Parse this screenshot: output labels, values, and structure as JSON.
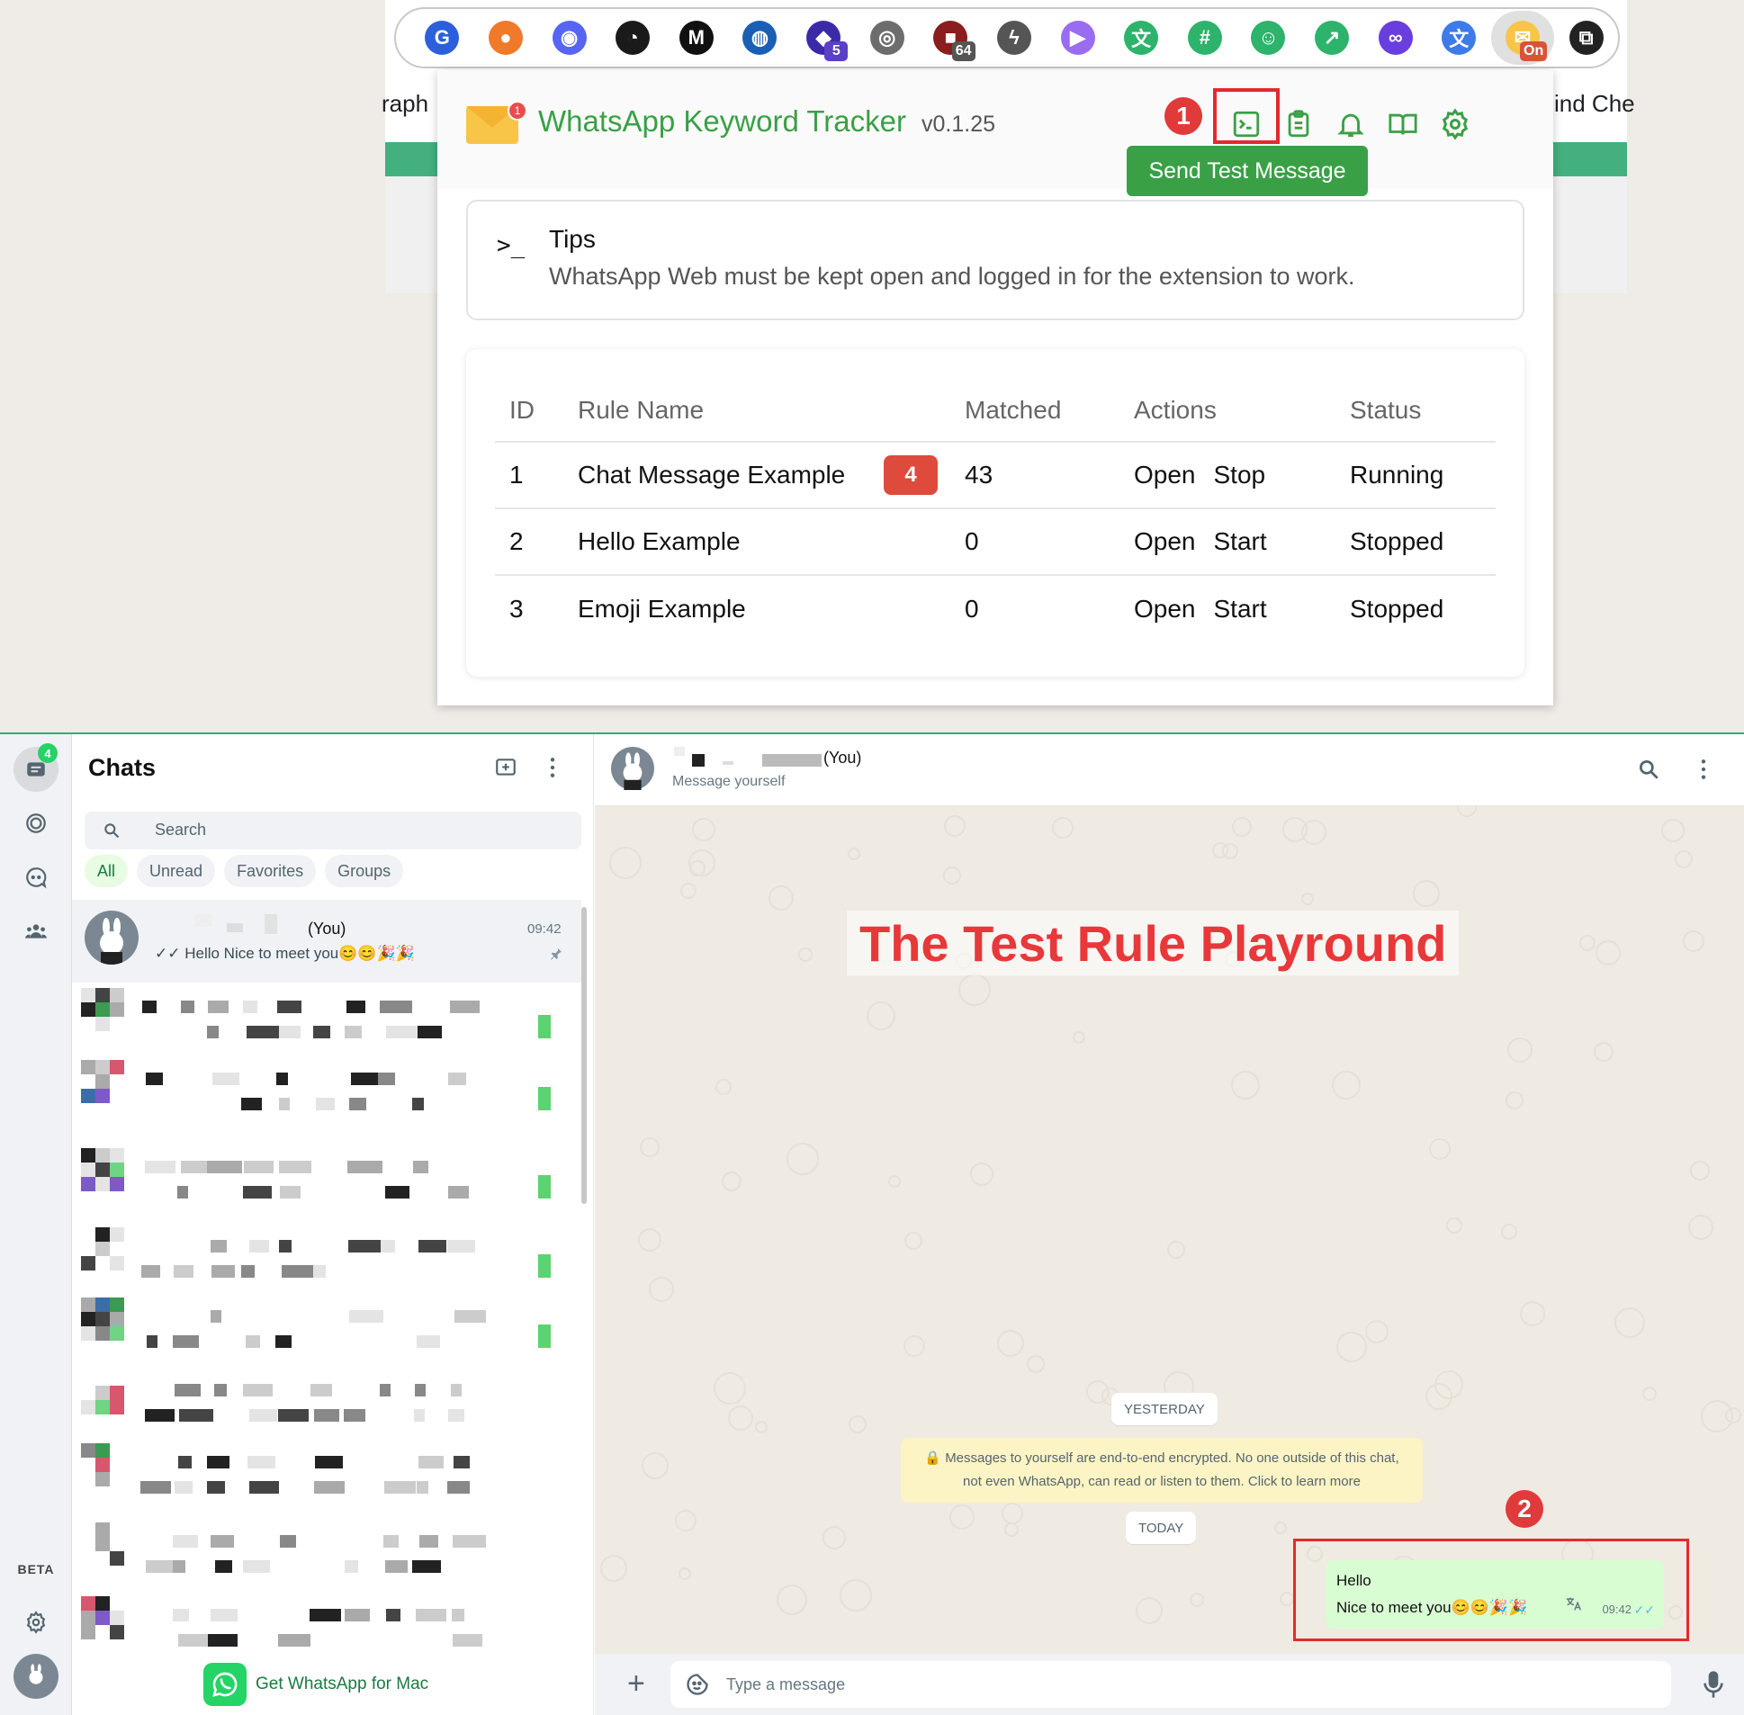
{
  "browser": {
    "left_side_text": "raph",
    "right_side_text": "ind Che",
    "extensions": [
      {
        "icon": "shield-g-icon",
        "color": "#2b5fdb",
        "glyph": "G",
        "badge": ""
      },
      {
        "icon": "flame-icon",
        "color": "#f07a2a",
        "glyph": "●",
        "badge": ""
      },
      {
        "icon": "discord-icon",
        "color": "#5865f2",
        "glyph": "◉",
        "badge": ""
      },
      {
        "icon": "gauge-icon",
        "color": "#1a1a1a",
        "glyph": "◔",
        "badge": ""
      },
      {
        "icon": "medium-icon",
        "color": "#111111",
        "glyph": "M",
        "badge": ""
      },
      {
        "icon": "password-lock-icon",
        "color": "#1a5fb4",
        "glyph": "◍",
        "badge": ""
      },
      {
        "icon": "graduation-cap-icon",
        "color": "#3b2aa8",
        "glyph": "◆",
        "badge": "5",
        "badge_color": "#5b3fc4"
      },
      {
        "icon": "monkey-icon",
        "color": "#6d6d6d",
        "glyph": "◎",
        "badge": ""
      },
      {
        "icon": "dark-red-app-icon",
        "color": "#8a1d1d",
        "glyph": "■",
        "badge": "64",
        "badge_color": "#555555"
      },
      {
        "icon": "bolt-icon",
        "color": "#555555",
        "glyph": "ϟ",
        "badge": ""
      },
      {
        "icon": "gradient-play-icon",
        "color": "#9a6cf0",
        "glyph": "▶",
        "badge": ""
      },
      {
        "icon": "translate-green-icon",
        "color": "#2db36b",
        "glyph": "文",
        "badge": ""
      },
      {
        "icon": "hashtag-icon",
        "color": "#2db36b",
        "glyph": "#",
        "badge": ""
      },
      {
        "icon": "person-icon",
        "color": "#2db36b",
        "glyph": "☺",
        "badge": ""
      },
      {
        "icon": "share-icon",
        "color": "#2db36b",
        "glyph": "↗",
        "badge": ""
      },
      {
        "icon": "infinity-icon",
        "color": "#6a3de0",
        "glyph": "∞",
        "badge": ""
      },
      {
        "icon": "translate-blue-icon",
        "color": "#3d7be8",
        "glyph": "文",
        "badge": ""
      },
      {
        "icon": "whatsapp-tracker-ext-icon",
        "color": "#f8c549",
        "glyph": "✉",
        "badge": "On",
        "badge_color": "#d9533a",
        "active": true
      },
      {
        "icon": "puzzle-icon",
        "color": "#222222",
        "glyph": "⧉",
        "badge": ""
      }
    ]
  },
  "popup": {
    "logo_badge": "1",
    "title": "WhatsApp Keyword Tracker",
    "version": "v0.1.25",
    "step_marker": "1",
    "tooltip": "Send Test Message",
    "header_icons": [
      "terminal-icon",
      "clipboard-icon",
      "bell-icon",
      "book-icon",
      "gear-icon"
    ],
    "accent": "#3aa046",
    "tips": {
      "icon_glyph": ">_",
      "title": "Tips",
      "text": "WhatsApp Web must be kept open and logged in for the extension to work."
    },
    "table": {
      "headers": {
        "id": "ID",
        "name": "Rule Name",
        "matched": "Matched",
        "actions": "Actions",
        "status": "Status"
      },
      "rows": [
        {
          "id": "1",
          "name": "Chat Message Example",
          "badge": "4",
          "matched": "43",
          "action_open": "Open",
          "action_toggle": "Stop",
          "status": "Running"
        },
        {
          "id": "2",
          "name": "Hello Example",
          "badge": "",
          "matched": "0",
          "action_open": "Open",
          "action_toggle": "Start",
          "status": "Stopped"
        },
        {
          "id": "3",
          "name": "Emoji Example",
          "badge": "",
          "matched": "0",
          "action_open": "Open",
          "action_toggle": "Start",
          "status": "Stopped"
        }
      ]
    }
  },
  "whatsapp": {
    "rail": {
      "chats_badge": "4",
      "beta": "BETA"
    },
    "chats": {
      "title": "Chats",
      "search_placeholder": "Search",
      "filters": [
        "All",
        "Unread",
        "Favorites",
        "Groups"
      ],
      "self_chat": {
        "name": "(You)",
        "time": "09:42",
        "preview": "✓✓ Hello Nice to meet you😊😊🎉🎉"
      },
      "get_app": "Get WhatsApp for Mac"
    },
    "conversation": {
      "name": "(You)",
      "subtitle": "Message yourself",
      "overlay_title": "The Test Rule Playround",
      "date_yesterday": "YESTERDAY",
      "system_message": "🔒 Messages to yourself are end-to-end encrypted. No one outside of this chat, not even WhatsApp, can read or listen to them. Click to learn more",
      "date_today": "TODAY",
      "step_marker": "2",
      "message": {
        "line1": "Hello",
        "line2": "Nice to meet you😊😊🎉🎉",
        "time": "09:42",
        "ticks": "✓✓"
      },
      "composer_placeholder": "Type a message"
    }
  }
}
